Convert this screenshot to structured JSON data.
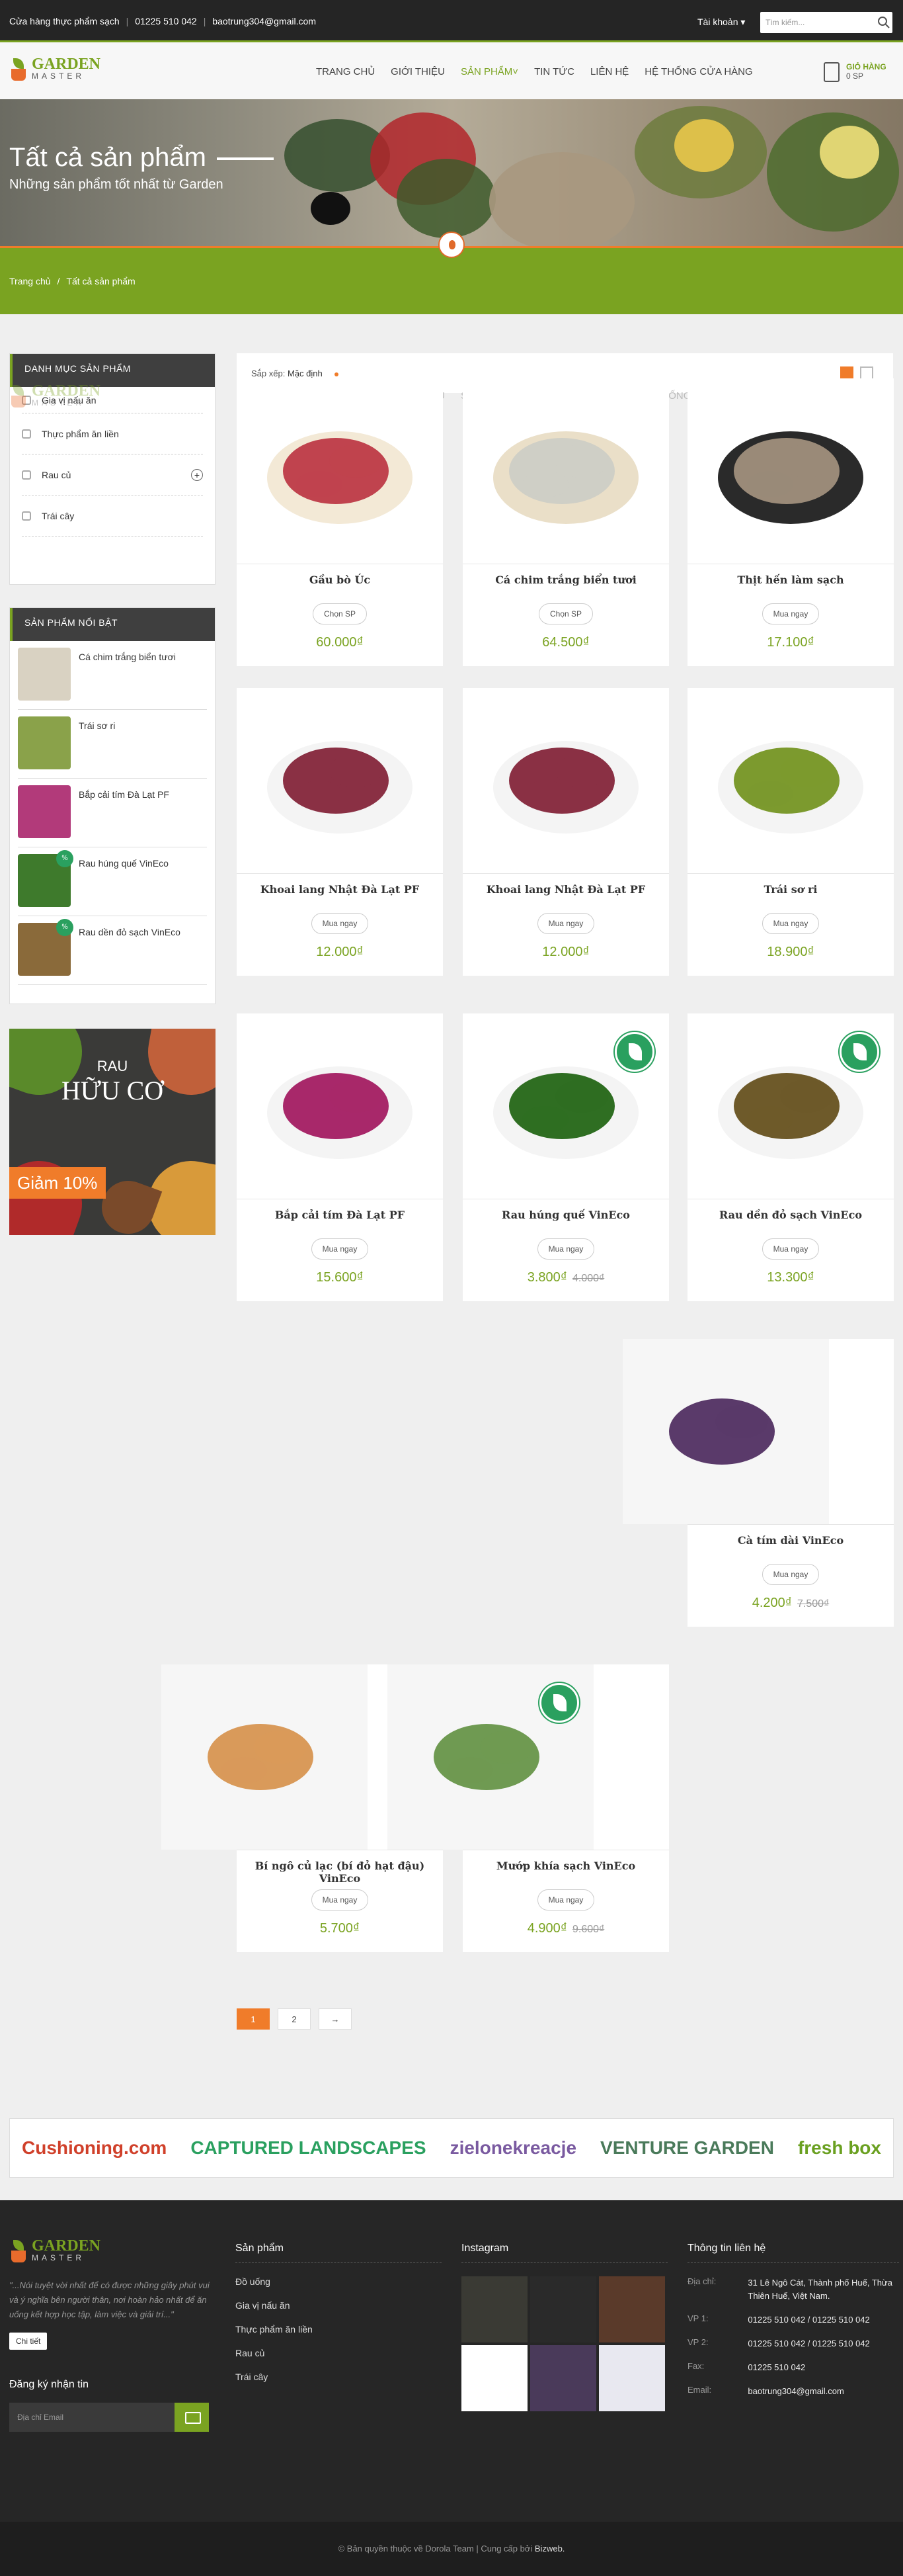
{
  "topbar": {
    "store": "Cửa hàng thực phẩm sạch",
    "phone": "01225 510 042",
    "email": "baotrung304@gmail.com",
    "account": "Tài khoản",
    "search_placeholder": "Tìm kiếm..."
  },
  "header": {
    "logo_main": "GARDEN",
    "logo_sub": "MASTER",
    "nav": [
      "TRANG CHỦ",
      "GIỚI THIỆU",
      "SẢN PHẨM",
      "TIN TỨC",
      "LIÊN HỆ",
      "HỆ THỐNG CỬA HÀNG"
    ],
    "cart_label": "GIỎ HÀNG",
    "cart_count": "0 SP"
  },
  "banner": {
    "title": "Tất cả sản phẩm",
    "subtitle": "Những sản phẩm tốt nhất từ Garden"
  },
  "breadcrumb": {
    "home": "Trang chủ",
    "sep": "/",
    "current": "Tất cả sản phẩm"
  },
  "sidebar": {
    "categories_title": "DANH MỤC SẢN PHẨM",
    "categories": [
      "Gia vị nấu ăn",
      "Thực phẩm ăn liền",
      "Rau củ",
      "Trái cây"
    ],
    "expand_symbol": "+",
    "featured_title": "SẢN PHẨM NỔI BẬT",
    "featured": [
      {
        "name": "Cá chim trắng biển tươi",
        "color": "#d9d2c2",
        "badge": ""
      },
      {
        "name": "Trái sơ ri",
        "color": "#8aa24a",
        "badge": ""
      },
      {
        "name": "Bắp cải tím Đà Lạt PF",
        "color": "#b23a7a",
        "badge": ""
      },
      {
        "name": "Rau húng quế VinEco",
        "color": "#3e7a2c",
        "badge": "%"
      },
      {
        "name": "Rau dền đỏ sạch VinEco",
        "color": "#8a6a3a",
        "badge": "%"
      }
    ],
    "promo": {
      "line1": "RAU",
      "line2": "HỮU CƠ",
      "discount": "Giảm 10%"
    }
  },
  "sort": {
    "label": "Sắp xếp:",
    "value": "Mặc định"
  },
  "products": [
    {
      "name": "Gầu bò Úc",
      "button": "Chọn SP",
      "price": "60.000₫",
      "old": "",
      "color": "#c0434e",
      "bg": "#f3e9d6",
      "veg": false
    },
    {
      "name": "Cá chim trắng biển tươi",
      "button": "Chọn SP",
      "price": "64.500₫",
      "old": "",
      "color": "#cfcfc6",
      "bg": "#eadfc8",
      "veg": false
    },
    {
      "name": "Thịt hến làm sạch",
      "button": "Mua ngay",
      "price": "17.100₫",
      "old": "",
      "color": "#9a8a78",
      "bg": "#2a2a2a",
      "veg": false
    },
    {
      "name": "Khoai lang Nhật Đà Lạt PF",
      "button": "Mua ngay",
      "price": "12.000₫",
      "old": "",
      "color": "#8a3044",
      "bg": "#ffffff",
      "veg": false
    },
    {
      "name": "Khoai lang Nhật Đà Lạt PF",
      "button": "Mua ngay",
      "price": "12.000₫",
      "old": "",
      "color": "#8a3044",
      "bg": "#ffffff",
      "veg": false
    },
    {
      "name": "Trái sơ ri",
      "button": "Mua ngay",
      "price": "18.900₫",
      "old": "",
      "color": "#7c9a2e",
      "bg": "#ffffff",
      "veg": false
    },
    {
      "name": "Bắp cải tím Đà Lạt PF",
      "button": "Mua ngay",
      "price": "15.600₫",
      "old": "",
      "color": "#a8286a",
      "bg": "#ffffff",
      "veg": false
    },
    {
      "name": "Rau húng quế VinEco",
      "button": "Mua ngay",
      "price": "3.800₫",
      "old": "4.000₫",
      "color": "#2f6e22",
      "bg": "#ffffff",
      "veg": true
    },
    {
      "name": "Rau dền đỏ sạch VinEco",
      "button": "Mua ngay",
      "price": "13.300₫",
      "old": "",
      "color": "#6e5a2a",
      "bg": "#ffffff",
      "veg": true
    },
    {
      "name": "Cà tím dài VinEco",
      "button": "Mua ngay",
      "price": "4.200₫",
      "old": "7.500₫",
      "color": "#5a3a6a",
      "bg": "#f6f6f6",
      "veg": false
    },
    {
      "name": "Bí ngô củ lạc (bí đỏ hạt đậu) VinEco",
      "button": "Mua ngay",
      "price": "5.700₫",
      "old": "",
      "color": "#d99a5a",
      "bg": "#f6f6f6",
      "veg": false
    },
    {
      "name": "Mướp khía sạch VinEco",
      "button": "Mua ngay",
      "price": "4.900₫",
      "old": "9.600₫",
      "color": "#6f9a52",
      "bg": "#f6f6f6",
      "veg": true
    }
  ],
  "pager": [
    "1",
    "2",
    "→"
  ],
  "brands": [
    {
      "name": "Cushioning.com",
      "color": "#d0402a"
    },
    {
      "name": "CAPTURED LANDSCAPES",
      "color": "#2aa05f"
    },
    {
      "name": "zielonekreacje",
      "color": "#7a5aa0"
    },
    {
      "name": "VENTURE GARDEN",
      "color": "#4a7a5a"
    },
    {
      "name": "fresh box",
      "color": "#6aa020"
    }
  ],
  "footer": {
    "about": "\"...Nói tuyệt vời nhất để có được những giây phút vui và ý nghĩa bên người thân, nơi hoàn hảo nhất để ăn uống kết hợp học tập, làm việc và giải trí...\"",
    "more": "Chi tiết",
    "newsletter_title": "Đăng ký nhận tin",
    "newsletter_placeholder": "Địa chỉ Email",
    "products_title": "Sản phẩm",
    "products_links": [
      "Đồ uống",
      "Gia vị nấu ăn",
      "Thực phẩm ăn liền",
      "Rau củ",
      "Trái cây"
    ],
    "instagram_title": "Instagram",
    "instagram": [
      "#3a3a34",
      "#2a2a2a",
      "#5a3a2a",
      "#ffffff",
      "#4a3a5a",
      "#e8e8f0"
    ],
    "contact_title": "Thông tin liên hệ",
    "contact": [
      {
        "k": "Địa chỉ:",
        "v": "31 Lê Ngô Cát, Thành phố Huế, Thừa Thiên Huế, Việt Nam."
      },
      {
        "k": "VP 1:",
        "v": "01225 510 042 / 01225 510 042"
      },
      {
        "k": "VP 2:",
        "v": "01225 510 042 / 01225 510 042"
      },
      {
        "k": "Fax:",
        "v": "01225 510 042"
      },
      {
        "k": "Email:",
        "v": "baotrung304@gmail.com"
      }
    ],
    "copyright": "© Bản quyền thuộc về Dorola Team | Cung cấp bởi",
    "provider": "Bizweb."
  },
  "colors": {
    "green": "#7aa321",
    "orange": "#f07c2a",
    "dark": "#262626"
  }
}
